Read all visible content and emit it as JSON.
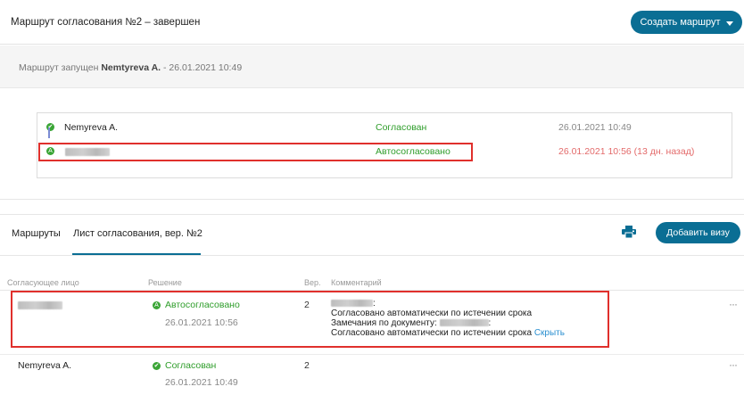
{
  "header": {
    "title": "Маршрут согласования №2 – завершен",
    "create_button": "Создать маршрут"
  },
  "launched": {
    "prefix": "Маршрут запущен ",
    "user": "Nemtyreva A.",
    "suffix": " - 26.01.2021 10:49"
  },
  "steps": [
    {
      "name": "Nemyreva A.",
      "status": "Согласован",
      "date": "26.01.2021 10:49"
    },
    {
      "name": "",
      "status": "Автосогласовано",
      "date": "26.01.2021 10:56 (13 дн.  назад)"
    }
  ],
  "tabs": {
    "routes": "Маршруты",
    "sheet": "Лист согласования, вер. №2"
  },
  "add_visa_button": "Добавить визу",
  "columns": {
    "person": "Согласующее лицо",
    "decision": "Решение",
    "version": "Вер.",
    "comment": "Комментарий"
  },
  "rows": [
    {
      "person": "",
      "decision": "Автосогласовано",
      "date": "26.01.2021 10:56",
      "version": "2",
      "comment_line1": ":",
      "comment_line2": "Согласовано автоматически по истечении срока",
      "comment_line3_prefix": "Замечания по документу:",
      "comment_line3_suffix": ":",
      "comment_line4": "Согласовано автоматически по истечении срока",
      "hide_link": "Скрыть",
      "more": "···"
    },
    {
      "person": "Nemyreva A.",
      "decision": "Согласован",
      "date": "26.01.2021 10:49",
      "version": "2",
      "more": "···"
    }
  ],
  "colors": {
    "accent": "#0a6e94",
    "success": "#3aa536",
    "overdue": "#e36a6a",
    "highlight": "#e0302c",
    "link": "#2a8fd0"
  }
}
